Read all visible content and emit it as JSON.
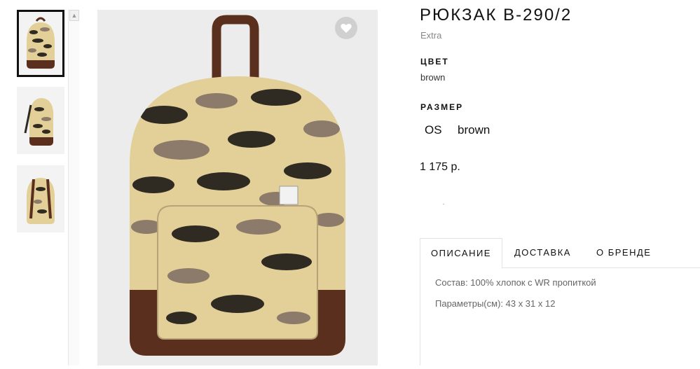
{
  "product": {
    "title": "РЮКЗАК B-290/2",
    "brand": "Extra",
    "color_label": "ЦВЕТ",
    "color_value": "brown",
    "size_label": "РАЗМЕР",
    "size_options": [
      "OS",
      "brown"
    ],
    "price": "1 175 р."
  },
  "gallery": {
    "thumbnails": [
      "front-view",
      "side-view",
      "back-view"
    ],
    "selected_index": 0,
    "favorite_icon": "heart-icon",
    "scroll_up_icon": "chevron-up-icon"
  },
  "tabs": [
    {
      "label": "ОПИСАНИЕ",
      "active": true
    },
    {
      "label": "ДОСТАВКА",
      "active": false
    },
    {
      "label": "О БРЕНДЕ",
      "active": false
    }
  ],
  "description": {
    "composition": "Состав: 100% хлопок с WR пропиткой",
    "parameters": "Параметры(см): 43 x 31 x 12"
  },
  "colors": {
    "camo_light": "#e3cf98",
    "camo_dark": "#2f2a22",
    "camo_mid": "#8c7a6a",
    "leather_brown": "#5a2f1e",
    "accent_border": "#111111"
  }
}
